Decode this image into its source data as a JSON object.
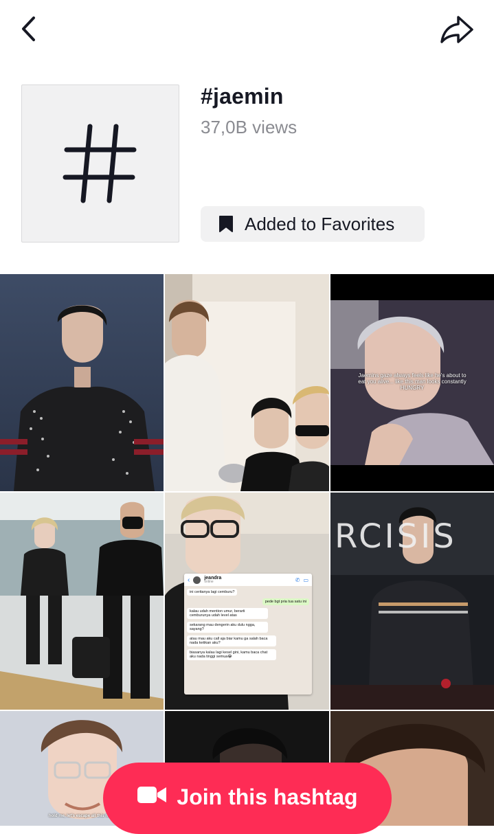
{
  "header": {
    "back_icon": "chevron-left-icon",
    "share_icon": "share-arrow-icon"
  },
  "hashtag": {
    "icon": "hashtag-icon",
    "title": "#jaemin",
    "views": "37,0B views",
    "favorite_label": "Added to Favorites",
    "favorite_icon": "bookmark-icon"
  },
  "videos": [
    {
      "caption": ""
    },
    {
      "caption": ""
    },
    {
      "caption": "Jaemins gaze always feels like he's about to eat you alive... like this man looks constantly HUNGRY"
    },
    {
      "caption": ""
    },
    {
      "chat": {
        "contact": "jeandra",
        "status": "online",
        "messages": [
          {
            "side": "left",
            "text": "ini ceritanya lagi cemburu?"
          },
          {
            "side": "right",
            "text": "pede bgt pria tua satu ini"
          },
          {
            "side": "left",
            "text": "kalau udah mention umur, berarti cemburunya udah level atas"
          },
          {
            "side": "left",
            "text": "sekarang mau dengerin aku dulu ngga, sayang?"
          },
          {
            "side": "left",
            "text": "atau mau aku call aja biar kamu ga salah baca nada ketikan aku?"
          },
          {
            "side": "left",
            "text": "biasanya kalau lagi kesel gini, kamu baca chat aku nada tinggi semua😂"
          }
        ]
      }
    },
    {
      "sign": "RCISIS"
    },
    {
      "caption": "hold me, let's escape all this noise"
    },
    {
      "caption": ""
    },
    {
      "caption": ""
    }
  ],
  "cta": {
    "label": "Join this hashtag",
    "icon": "video-camera-icon",
    "color": "#fe2c55"
  }
}
